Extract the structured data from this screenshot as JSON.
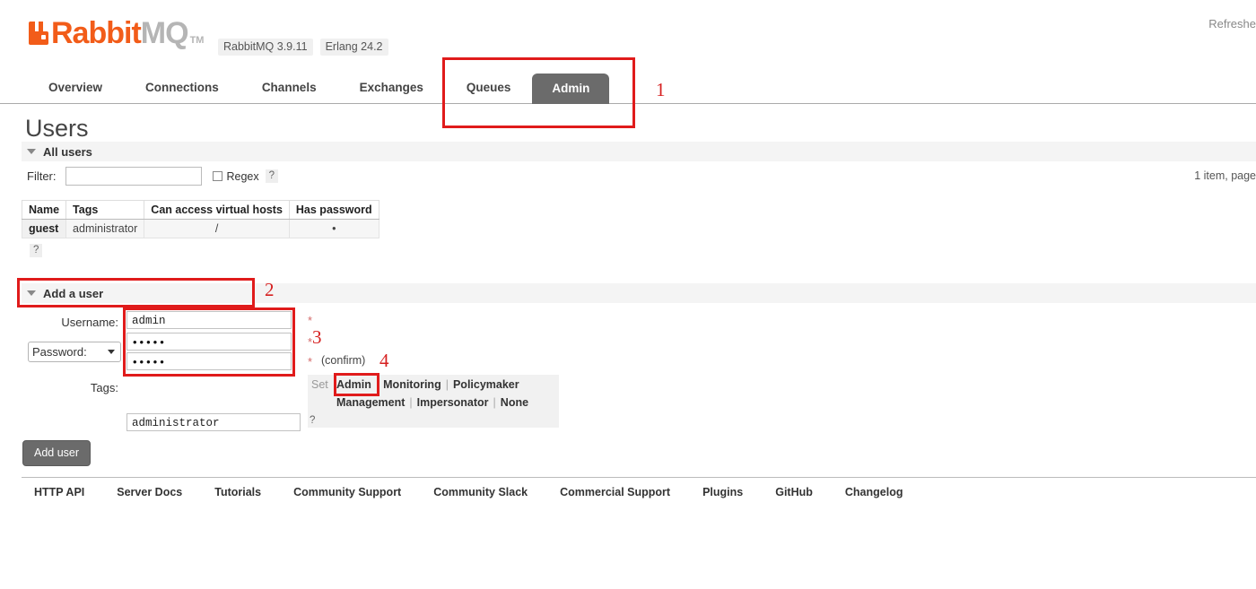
{
  "header": {
    "logo_rabbit": "Rabbit",
    "logo_mq": "MQ",
    "logo_tm": "TM",
    "version_rabbitmq": "RabbitMQ 3.9.11",
    "version_erlang": "Erlang 24.2",
    "refresh_note": "Refreshe",
    "accent_color": "#F25C19"
  },
  "nav": {
    "items": [
      {
        "label": "Overview",
        "active": false
      },
      {
        "label": "Connections",
        "active": false
      },
      {
        "label": "Channels",
        "active": false
      },
      {
        "label": "Exchanges",
        "active": false
      },
      {
        "label": "Queues",
        "active": false
      },
      {
        "label": "Admin",
        "active": true
      }
    ],
    "active_bg": "#6b6b6b"
  },
  "page": {
    "title": "Users"
  },
  "all_users": {
    "section_label": "All users",
    "filter_label": "Filter:",
    "filter_value": "",
    "filter_placeholder": "",
    "regex_label": "Regex",
    "regex_checked": false,
    "help_mark": "?",
    "item_count": "1 item, page",
    "table": {
      "columns": [
        "Name",
        "Tags",
        "Can access virtual hosts",
        "Has password"
      ],
      "rows": [
        {
          "name": "guest",
          "tags": "administrator",
          "vhosts": "/",
          "has_password": "•"
        }
      ]
    },
    "table_help": "?"
  },
  "add_user": {
    "section_label": "Add a user",
    "username_label": "Username:",
    "username_value": "admin",
    "password_select_label": "Password:",
    "password_value": "•••••",
    "password_confirm_value": "•••••",
    "confirm_text": "(confirm)",
    "required_star": "*",
    "tags_label": "Tags:",
    "tags_value": "administrator",
    "tags_help": "?",
    "tag_set_label": "Set",
    "tag_options_line1": [
      "Admin",
      "Monitoring",
      "Policymaker"
    ],
    "tag_options_line2": [
      "Management",
      "Impersonator",
      "None"
    ],
    "tag_separator": "|",
    "submit_label": "Add user"
  },
  "footer": {
    "links": [
      "HTTP API",
      "Server Docs",
      "Tutorials",
      "Community Support",
      "Community Slack",
      "Commercial Support",
      "Plugins",
      "GitHub",
      "Changelog"
    ]
  },
  "annotations": {
    "color": "#e01b1b",
    "numbers": [
      "1",
      "2",
      "3",
      "4"
    ]
  }
}
